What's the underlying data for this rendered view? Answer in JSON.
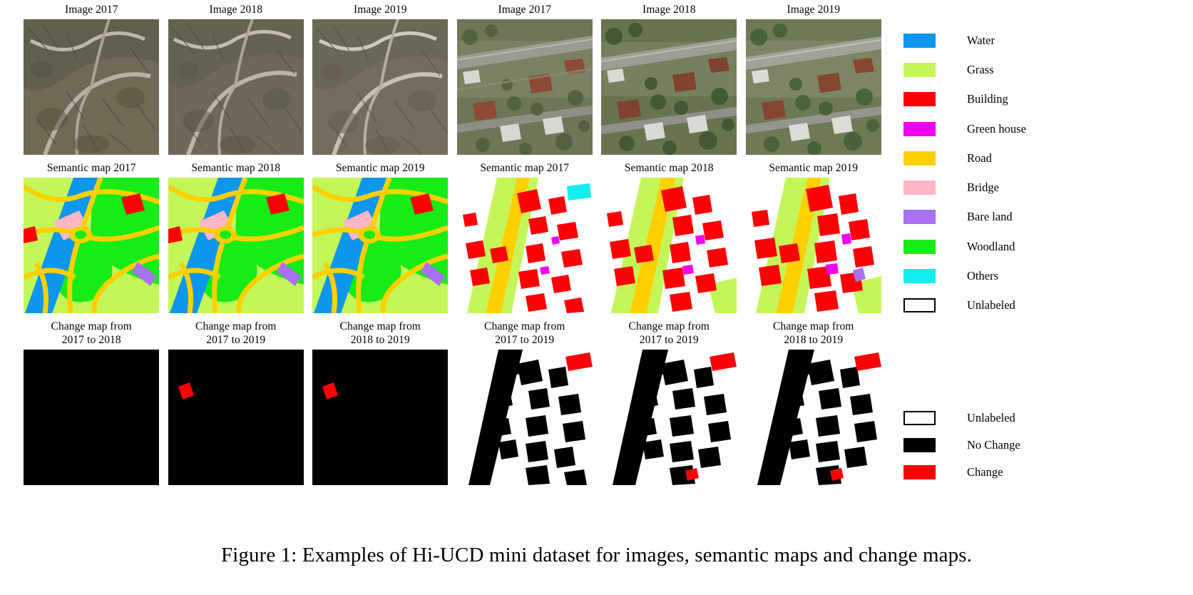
{
  "figure": {
    "caption": "Figure 1: Examples of Hi-UCD mini dataset for images, semantic maps and change maps."
  },
  "grid": {
    "rows": [
      {
        "name": "images",
        "cells": [
          {
            "title": "Image 2017",
            "kind": "aerial-scene-a-2017"
          },
          {
            "title": "Image 2018",
            "kind": "aerial-scene-a-2018"
          },
          {
            "title": "Image 2019",
            "kind": "aerial-scene-a-2019"
          },
          {
            "title": "Image 2017",
            "kind": "aerial-scene-b-2017"
          },
          {
            "title": "Image 2018",
            "kind": "aerial-scene-b-2018"
          },
          {
            "title": "Image 2019",
            "kind": "aerial-scene-b-2019"
          }
        ]
      },
      {
        "name": "semantic-maps",
        "cells": [
          {
            "title": "Semantic map 2017",
            "kind": "semantic-a-2017"
          },
          {
            "title": "Semantic map 2018",
            "kind": "semantic-a-2018"
          },
          {
            "title": "Semantic map 2019",
            "kind": "semantic-a-2019"
          },
          {
            "title": "Semantic map 2017",
            "kind": "semantic-b-2017"
          },
          {
            "title": "Semantic map 2018",
            "kind": "semantic-b-2018"
          },
          {
            "title": "Semantic map 2019",
            "kind": "semantic-b-2019"
          }
        ]
      },
      {
        "name": "change-maps",
        "cells": [
          {
            "title": "Change map from\n2017 to 2018",
            "kind": "change-a-17-18"
          },
          {
            "title": "Change map from\n2017 to 2019",
            "kind": "change-a-17-19"
          },
          {
            "title": "Change map from\n2018 to 2019",
            "kind": "change-a-18-19"
          },
          {
            "title": "Change map from\n2017 to 2019",
            "kind": "change-b-17-19a"
          },
          {
            "title": "Change map from\n2017 to 2019",
            "kind": "change-b-17-19b"
          },
          {
            "title": "Change map from\n2018 to 2019",
            "kind": "change-b-18-19"
          }
        ]
      }
    ]
  },
  "legend_classes": {
    "items": [
      {
        "label": "Water",
        "color": "#0d96ec",
        "outline": false
      },
      {
        "label": "Grass",
        "color": "#c3f759",
        "outline": false
      },
      {
        "label": "Building",
        "color": "#fc0006",
        "outline": false
      },
      {
        "label": "Green house",
        "color": "#ef00ef",
        "outline": false
      },
      {
        "label": "Road",
        "color": "#ffd000",
        "outline": false
      },
      {
        "label": "Bridge",
        "color": "#ffb6c6",
        "outline": false
      },
      {
        "label": "Bare land",
        "color": "#a772ef",
        "outline": false
      },
      {
        "label": "Woodland",
        "color": "#17ec17",
        "outline": false
      },
      {
        "label": "Others",
        "color": "#14eded",
        "outline": false
      },
      {
        "label": "Unlabeled",
        "color": "#ffffff",
        "outline": true
      }
    ]
  },
  "legend_change": {
    "items": [
      {
        "label": "Unlabeled",
        "color": "#ffffff",
        "outline": true
      },
      {
        "label": "No Change",
        "color": "#000000",
        "outline": false
      },
      {
        "label": "Change",
        "color": "#fc0006",
        "outline": false
      }
    ]
  },
  "palette": {
    "water": "#0d96ec",
    "grass": "#c3f759",
    "building": "#fc0006",
    "green_house": "#ef00ef",
    "road": "#ffd000",
    "bridge": "#ffb6c6",
    "bare_land": "#a772ef",
    "woodland": "#17ec17",
    "others": "#14eded",
    "unlabeled": "#ffffff",
    "no_change": "#000000",
    "change": "#fc0006"
  }
}
